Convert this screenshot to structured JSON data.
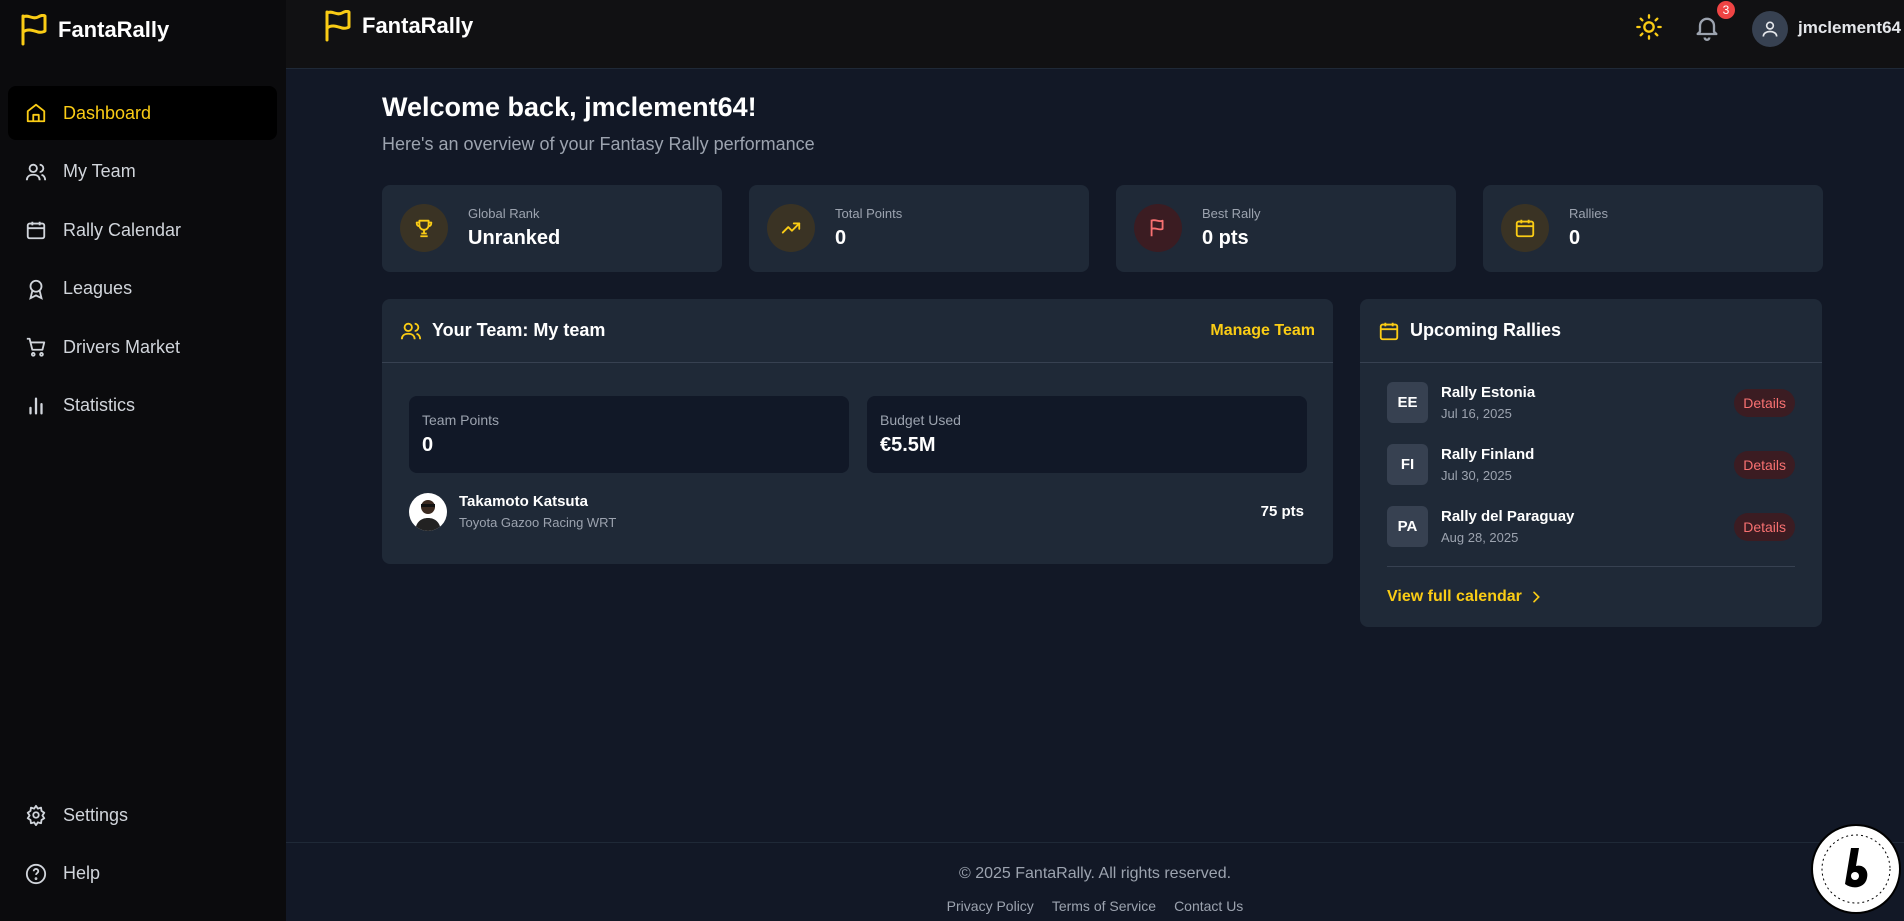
{
  "app": {
    "name": "FantaRally"
  },
  "sidebar": {
    "items": [
      {
        "label": "Dashboard"
      },
      {
        "label": "My Team"
      },
      {
        "label": "Rally Calendar"
      },
      {
        "label": "Leagues"
      },
      {
        "label": "Drivers Market"
      },
      {
        "label": "Statistics"
      }
    ],
    "bottom": [
      {
        "label": "Settings"
      },
      {
        "label": "Help"
      }
    ]
  },
  "header": {
    "notifications": "3",
    "username": "jmclement64"
  },
  "main": {
    "welcome": "Welcome back, jmclement64!",
    "subtitle": "Here's an overview of your Fantasy Rally performance",
    "stats": [
      {
        "label": "Global Rank",
        "value": "Unranked"
      },
      {
        "label": "Total Points",
        "value": "0"
      },
      {
        "label": "Best Rally",
        "value": "0 pts"
      },
      {
        "label": "Rallies",
        "value": "0"
      }
    ],
    "team": {
      "title": "Your Team: My team",
      "manage": "Manage Team",
      "points_label": "Team Points",
      "points_value": "0",
      "budget_label": "Budget Used",
      "budget_value": "€5.5M",
      "drivers": [
        {
          "name": "Takamoto Katsuta",
          "team": "Toyota Gazoo Racing WRT",
          "points": "75 pts"
        }
      ]
    },
    "upcoming": {
      "title": "Upcoming Rallies",
      "rallies": [
        {
          "code": "EE",
          "name": "Rally Estonia",
          "date": "Jul 16, 2025",
          "action": "Details"
        },
        {
          "code": "FI",
          "name": "Rally Finland",
          "date": "Jul 30, 2025",
          "action": "Details"
        },
        {
          "code": "PA",
          "name": "Rally del Paraguay",
          "date": "Aug 28, 2025",
          "action": "Details"
        }
      ],
      "view_all": "View full calendar"
    }
  },
  "footer": {
    "copyright": "© 2025 FantaRally. All rights reserved.",
    "links": [
      "Privacy Policy",
      "Terms of Service",
      "Contact Us"
    ]
  },
  "colors": {
    "accent": "#facc15",
    "background": "#121826",
    "card": "#1f2937",
    "sidebar": "#0b0b0d",
    "danger": "#f87171"
  }
}
